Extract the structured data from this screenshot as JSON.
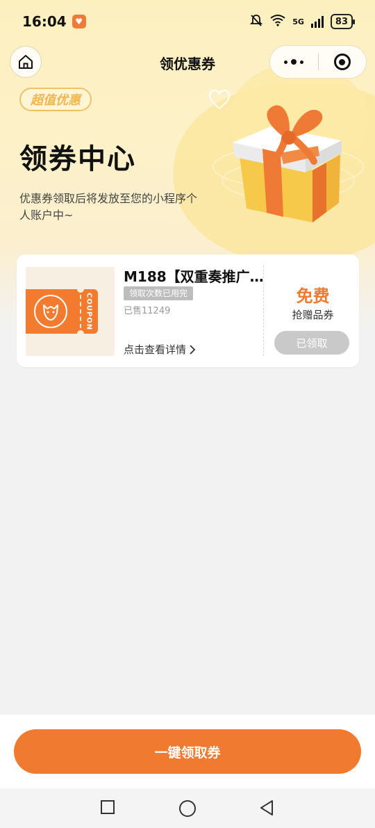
{
  "status_bar": {
    "time": "16:04",
    "network": "5G",
    "battery": "83"
  },
  "nav": {
    "title": "领优惠券"
  },
  "hero": {
    "tag": "超值优惠",
    "title": "领券中心",
    "description": "优惠券领取后将发放至您的小程序个人账户中~"
  },
  "coupon": {
    "thumb_label": "COUPON",
    "title": "M188【双重奏推广...",
    "limit_badge": "领取次数已用完",
    "sold": "已售11249",
    "detail_link": "点击查看详情",
    "price": "免费",
    "price_sub": "抢赠品券",
    "button": "已领取"
  },
  "bottom": {
    "claim_all": "一键领取券"
  },
  "colors": {
    "accent": "#f07a2f",
    "hero_bg": "#fdf0bf",
    "tag_color": "#f3b64f",
    "disabled": "#c9c9c9"
  }
}
